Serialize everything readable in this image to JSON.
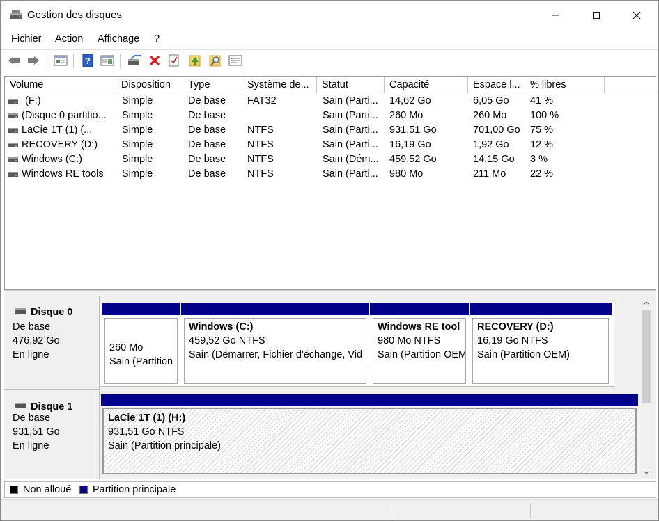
{
  "window": {
    "title": "Gestion des disques",
    "minimize": "—",
    "maximize": "☐",
    "close": "✕"
  },
  "menu": [
    "Fichier",
    "Action",
    "Affichage",
    "?"
  ],
  "toolbar": {
    "icons": [
      "back-arrow-icon",
      "forward-arrow-icon",
      "disk-list-icon",
      "help-icon",
      "properties-pane-icon",
      "connect-drive-icon",
      "delete-icon",
      "checklist-icon",
      "up-folder-icon",
      "search-folder-icon",
      "details-icon"
    ]
  },
  "volumes": {
    "headers": [
      "Volume",
      "Disposition",
      "Type",
      "Système de...",
      "Statut",
      "Capacité",
      "Espace l...",
      "% libres"
    ],
    "rows": [
      [
        "(F:)",
        "Simple",
        "De base",
        "FAT32",
        "Sain (Parti...",
        "14,62 Go",
        "6,05 Go",
        "41 %"
      ],
      [
        "(Disque 0 partitio...",
        "Simple",
        "De base",
        "",
        "Sain (Parti...",
        "260 Mo",
        "260 Mo",
        "100 %"
      ],
      [
        "LaCie 1T (1) (...",
        "Simple",
        "De base",
        "NTFS",
        "Sain (Parti...",
        "931,51 Go",
        "701,00 Go",
        "75 %"
      ],
      [
        "RECOVERY (D:)",
        "Simple",
        "De base",
        "NTFS",
        "Sain (Parti...",
        "16,19 Go",
        "1,92 Go",
        "12 %"
      ],
      [
        "Windows (C:)",
        "Simple",
        "De base",
        "NTFS",
        "Sain (Dém...",
        "459,52 Go",
        "14,15 Go",
        "3 %"
      ],
      [
        "Windows RE tools",
        "Simple",
        "De base",
        "NTFS",
        "Sain (Parti...",
        "980 Mo",
        "211 Mo",
        "22 %"
      ]
    ]
  },
  "disks": [
    {
      "name": "Disque 0",
      "kind": "De base",
      "size": "476,92 Go",
      "state": "En ligne",
      "partitions": [
        {
          "title": "",
          "size": "260 Mo",
          "status": "Sain (Partition"
        },
        {
          "title": "Windows  (C:)",
          "size": "459,52 Go NTFS",
          "status": "Sain (Démarrer, Fichier d'échange, Vid"
        },
        {
          "title": "Windows RE tool",
          "size": "980 Mo NTFS",
          "status": "Sain (Partition OEM"
        },
        {
          "title": "RECOVERY  (D:)",
          "size": "16,19 Go NTFS",
          "status": "Sain (Partition OEM)"
        }
      ]
    },
    {
      "name": "Disque 1",
      "kind": "De base",
      "size": "931,51 Go",
      "state": "En ligne",
      "partitions": [
        {
          "title": "LaCie 1T (1)  (H:)",
          "size": "931,51 Go NTFS",
          "status": "Sain (Partition principale)"
        }
      ]
    }
  ],
  "legend": [
    {
      "label": "Non alloué",
      "color": "#000000"
    },
    {
      "label": "Partition principale",
      "color": "#00008b"
    }
  ],
  "colors": {
    "partition_bar": "#00008b",
    "unallocated": "#000000"
  }
}
